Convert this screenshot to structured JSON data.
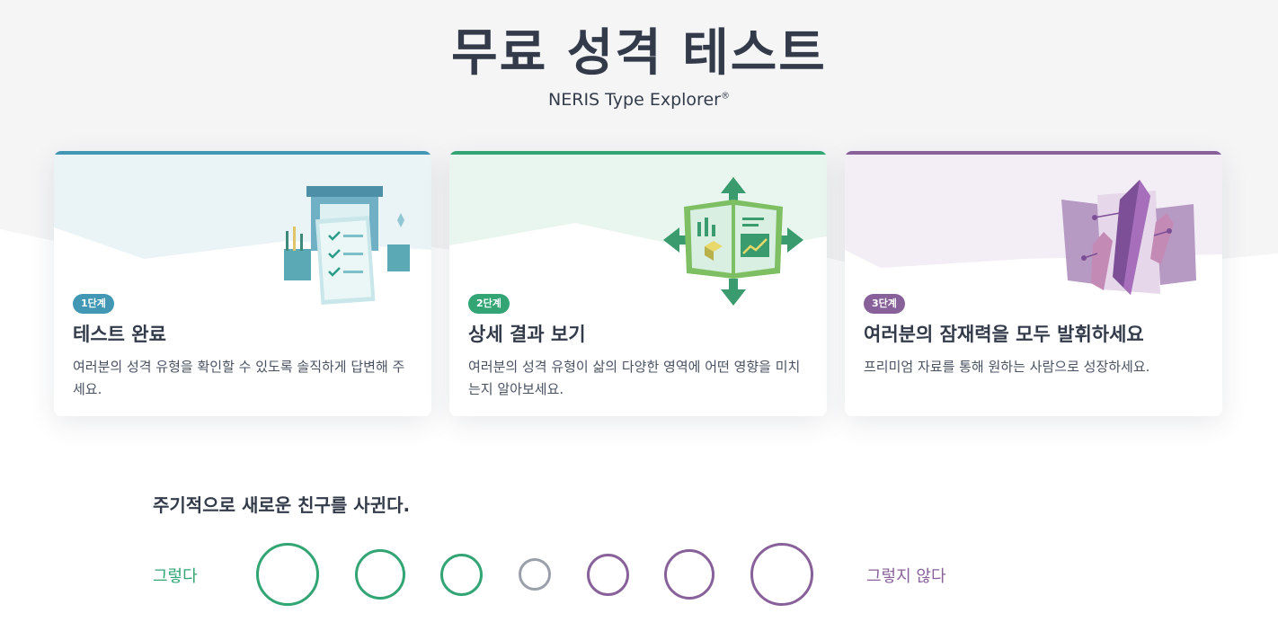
{
  "header": {
    "title": "무료 성격 테스트",
    "subtitle": "NERIS Type Explorer",
    "subtitle_mark": "®"
  },
  "cards": [
    {
      "step": "1단계",
      "title": "테스트 완료",
      "description": "여러분의 성격 유형을 확인할 수 있도록 솔직하게 답변해 주세요.",
      "color": "#4298b4",
      "illustration": "checklist-clipboard-icon"
    },
    {
      "step": "2단계",
      "title": "상세 결과 보기",
      "description": "여러분의 성격 유형이 삶의 다양한 영역에 어떤 영향을 미치는지 알아보세요.",
      "color": "#33a474",
      "illustration": "open-book-chart-icon"
    },
    {
      "step": "3단계",
      "title": "여러분의 잠재력을 모두 발휘하세요",
      "description": "프리미엄 자료를 통해 원하는 사람으로 성장하세요.",
      "color": "#88619a",
      "illustration": "crystal-map-icon"
    }
  ],
  "question": {
    "text": "주기적으로 새로운 친구를 사귄다.",
    "agree_label": "그렇다",
    "disagree_label": "그렇지 않다",
    "agree_color": "#33a474",
    "neutral_color": "#9a9fa9",
    "disagree_color": "#88619a"
  }
}
